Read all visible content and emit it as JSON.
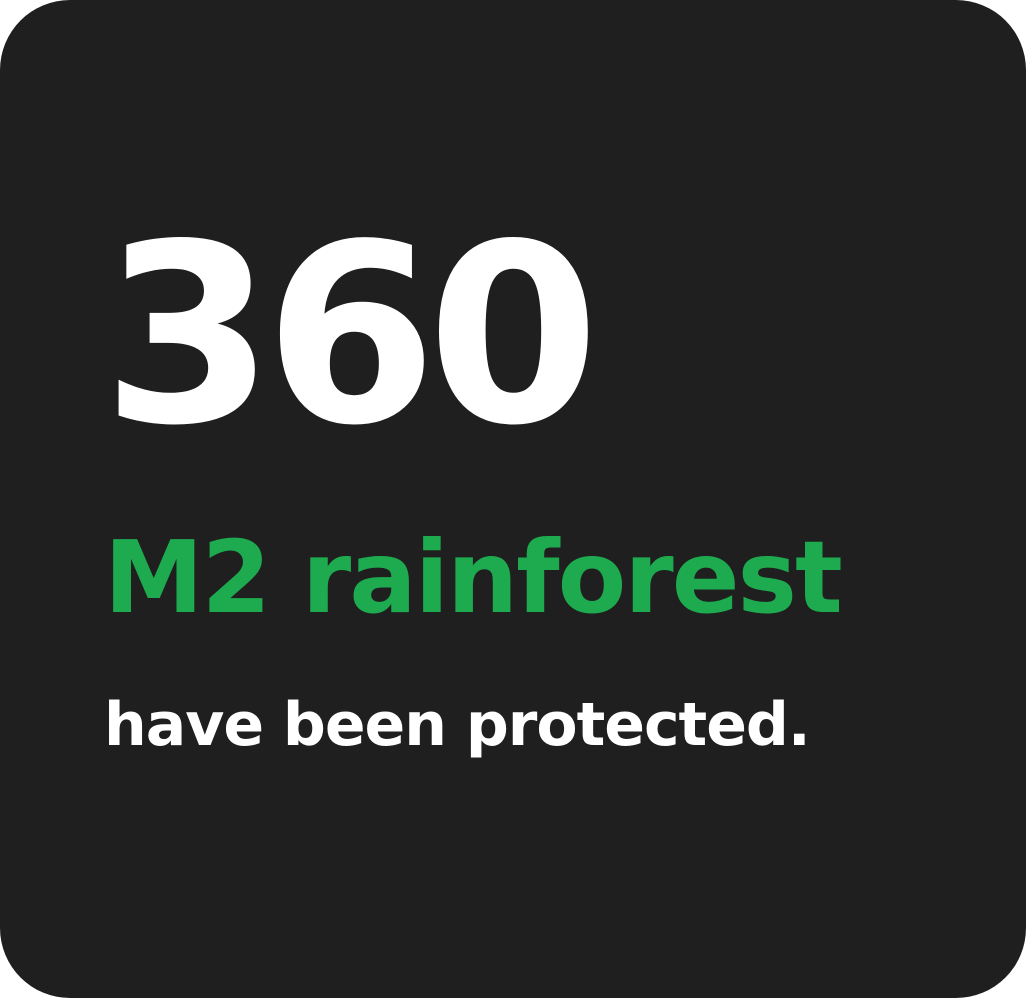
{
  "card": {
    "number": "360",
    "unit": "M2 rainforest",
    "caption": "have been protected."
  },
  "colors": {
    "background": "#1f1f1f",
    "number_text": "#ffffff",
    "unit_text": "#1eab4f",
    "caption_text": "#ffffff"
  }
}
